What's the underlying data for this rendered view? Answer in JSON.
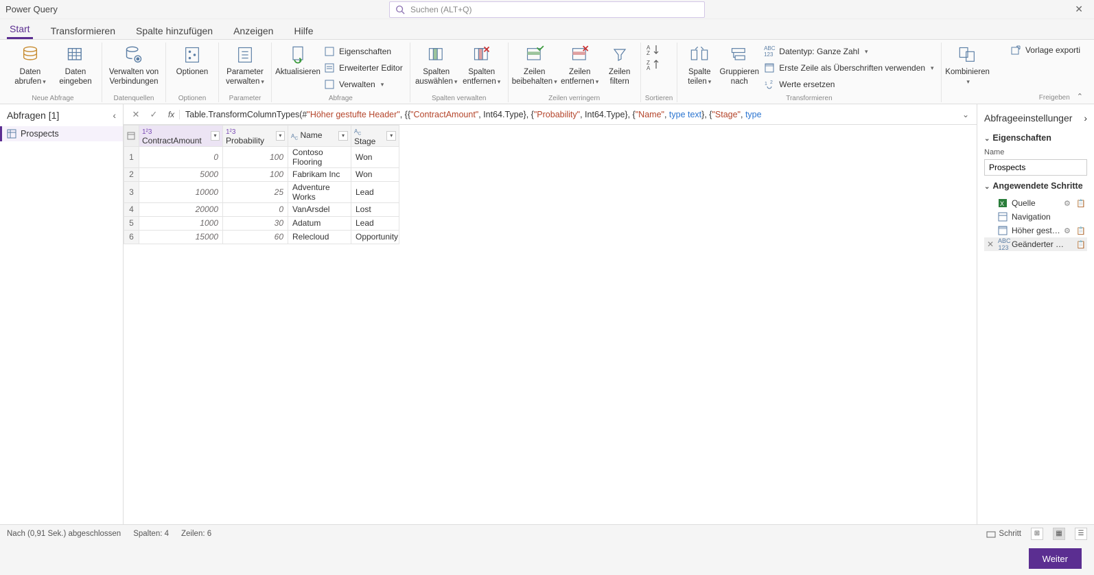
{
  "app": {
    "title": "Power Query"
  },
  "search": {
    "placeholder": "Suchen (ALT+Q)"
  },
  "tabs": {
    "start": "Start",
    "transform": "Transformieren",
    "addcol": "Spalte hinzufügen",
    "view": "Anzeigen",
    "help": "Hilfe"
  },
  "ribbon": {
    "groups": {
      "newquery": "Neue Abfrage",
      "datasources": "Datenquellen",
      "options": "Optionen",
      "parameter": "Parameter",
      "query": "Abfrage",
      "managecols": "Spalten verwalten",
      "reducerows": "Zeilen verringern",
      "sort": "Sortieren",
      "transform": "Transformieren",
      "share": "Freigeben"
    },
    "get_data": "Daten\nabrufen",
    "enter_data": "Daten\neingeben",
    "manage_conn": "Verwalten von\nVerbindungen",
    "options_btn": "Optionen",
    "manage_param": "Parameter\nverwalten",
    "refresh": "Aktualisieren",
    "properties": "Eigenschaften",
    "adv_editor": "Erweiterter Editor",
    "manage": "Verwalten",
    "choose_cols": "Spalten\nauswählen",
    "remove_cols": "Spalten\nentfernen",
    "keep_rows": "Zeilen\nbeibehalten",
    "remove_rows": "Zeilen\nentfernen",
    "filter_rows": "Zeilen\nfiltern",
    "split_col": "Spalte\nteilen",
    "group_by": "Gruppieren\nnach",
    "datatype": "Datentyp: Ganze Zahl",
    "first_row": "Erste Zeile als Überschriften verwenden",
    "replace": "Werte ersetzen",
    "combine": "Kombinieren",
    "export_tpl": "Vorlage exporti"
  },
  "queries": {
    "title": "Abfragen [1]",
    "items": [
      "Prospects"
    ]
  },
  "formula": {
    "prefix": "Table.TransformColumnTypes(#",
    "s1": "\"Höher gestufte Header\"",
    "mid1": ", {{",
    "s2": "\"ContractAmount\"",
    "mid2": ", Int64.Type}, {",
    "s3": "\"Probability\"",
    "mid3": ", Int64.Type}, {",
    "s4": "\"Name\"",
    "mid4": ", ",
    "kw1": "type text",
    "mid5": "}, {",
    "s5": "\"Stage\"",
    "mid6": ", ",
    "kw2": "type"
  },
  "columns": {
    "ca": "ContractAmount",
    "pr": "Probability",
    "nm": "Name",
    "st": "Stage"
  },
  "coltypes": {
    "num": "1²3",
    "txt": "ABC"
  },
  "rows": [
    {
      "ca": "0",
      "pr": "100",
      "nm": "Contoso Flooring",
      "st": "Won"
    },
    {
      "ca": "5000",
      "pr": "100",
      "nm": "Fabrikam Inc",
      "st": "Won"
    },
    {
      "ca": "10000",
      "pr": "25",
      "nm": "Adventure Works",
      "st": "Lead"
    },
    {
      "ca": "20000",
      "pr": "0",
      "nm": "VanArsdel",
      "st": "Lost"
    },
    {
      "ca": "1000",
      "pr": "30",
      "nm": "Adatum",
      "st": "Lead"
    },
    {
      "ca": "15000",
      "pr": "60",
      "nm": "Relecloud",
      "st": "Opportunity"
    }
  ],
  "settings": {
    "title": "Abfrageeinstellunger",
    "properties": "Eigenschaften",
    "name_label": "Name",
    "name_value": "Prospects",
    "applied": "Angewendete Schritte",
    "steps": {
      "source": "Quelle",
      "nav": "Navigation",
      "promote": "Höher gest…",
      "changed": "Geänderter …"
    }
  },
  "status": {
    "left": "Nach (0,91 Sek.) abgeschlossen",
    "cols": "Spalten: 4",
    "rows": "Zeilen: 6",
    "step": "Schritt"
  },
  "footer": {
    "next": "Weiter"
  }
}
